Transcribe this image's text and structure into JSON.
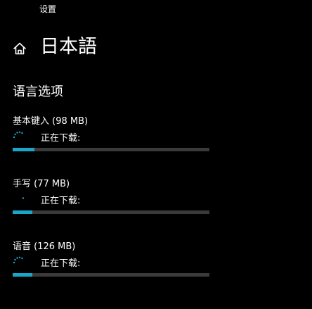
{
  "app": {
    "title": "设置"
  },
  "page": {
    "title": "日本語"
  },
  "section": {
    "title": "语言选项"
  },
  "features": [
    {
      "name": "基本键入 (98 MB)",
      "status": "正在下载:",
      "progress": 0.11
    },
    {
      "name": "手写 (77 MB)",
      "status": "正在下载:",
      "progress": 0.1
    },
    {
      "name": "语音 (126 MB)",
      "status": "正在下载:",
      "progress": 0.1
    }
  ],
  "colors": {
    "background": "#000000",
    "text": "#ffffff",
    "accent": "#1ba6c9",
    "track": "#3a3a3a"
  },
  "icons": {
    "home": "home-icon",
    "spinner": "spinner-icon"
  }
}
